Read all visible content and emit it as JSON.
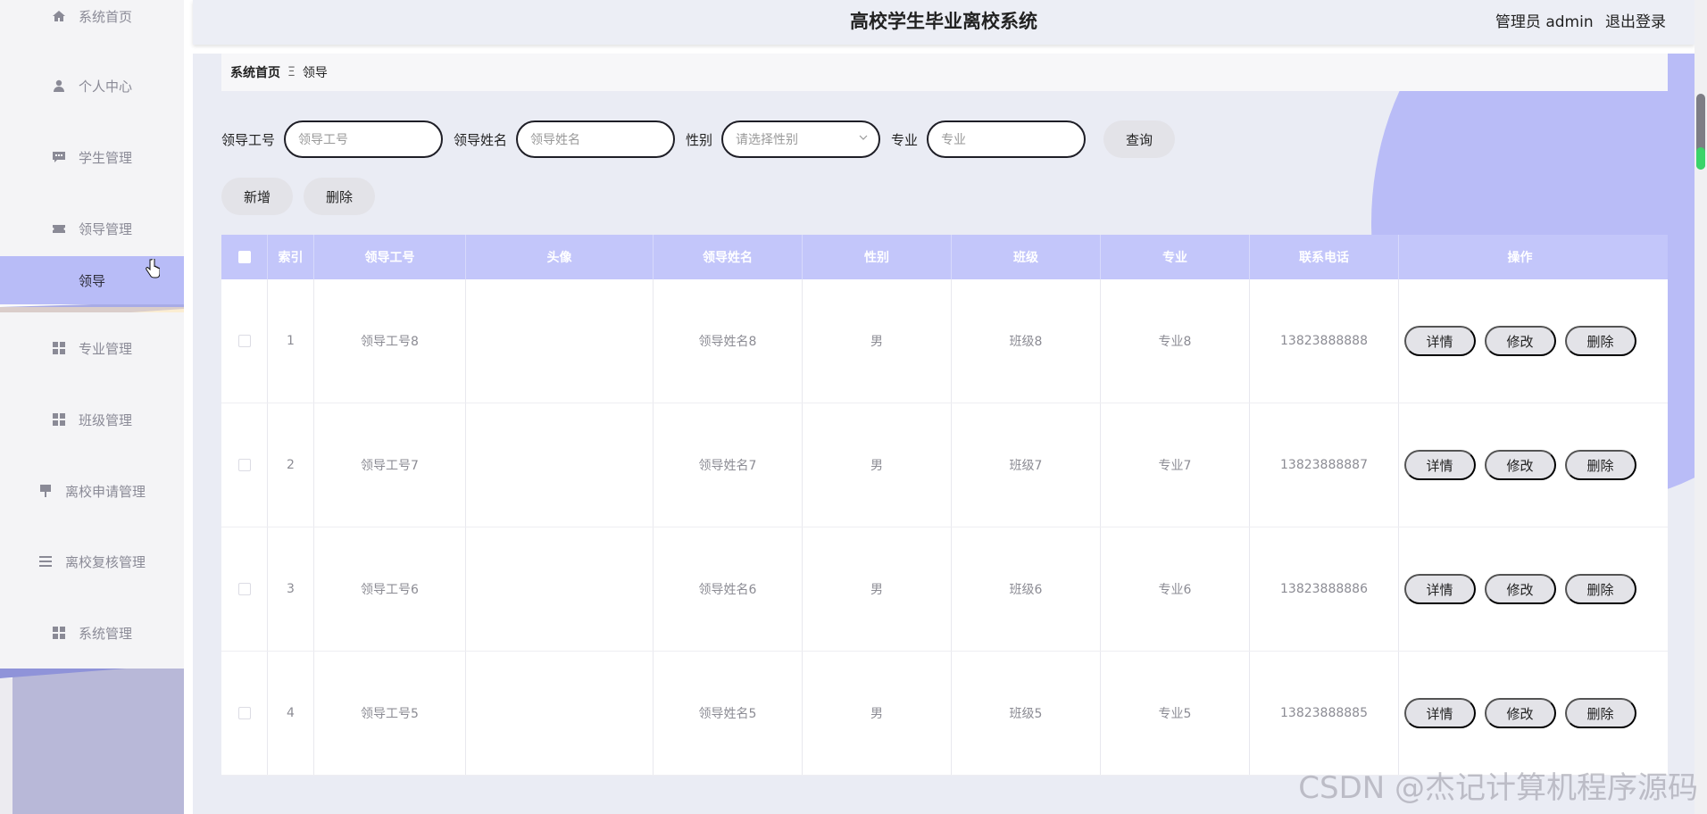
{
  "header": {
    "title": "高校学生毕业离校系统",
    "user_label": "管理员 admin",
    "logout_label": "退出登录"
  },
  "sidebar": {
    "items": [
      {
        "label": "系统首页",
        "icon": "home-icon"
      },
      {
        "label": "个人中心",
        "icon": "user-icon"
      },
      {
        "label": "学生管理",
        "icon": "chat-icon"
      },
      {
        "label": "领导管理",
        "icon": "ticket-icon"
      },
      {
        "label": "领导",
        "icon": "",
        "sub": true,
        "active": true
      },
      {
        "label": "专业管理",
        "icon": "grid-icon"
      },
      {
        "label": "班级管理",
        "icon": "grid-icon"
      },
      {
        "label": "离校申请管理",
        "icon": "flag-icon"
      },
      {
        "label": "离校复核管理",
        "icon": "list-icon"
      },
      {
        "label": "系统管理",
        "icon": "grid-icon"
      }
    ]
  },
  "breadcrumb": {
    "home": "系统首页",
    "separator": "Ξ",
    "current": "领导"
  },
  "search": {
    "id_label": "领导工号",
    "id_placeholder": "领导工号",
    "name_label": "领导姓名",
    "name_placeholder": "领导姓名",
    "gender_label": "性别",
    "gender_placeholder": "请选择性别",
    "major_label": "专业",
    "major_placeholder": "专业",
    "query_label": "查询"
  },
  "actions": {
    "add_label": "新增",
    "delete_label": "删除"
  },
  "table": {
    "headers": [
      "索引",
      "领导工号",
      "头像",
      "领导姓名",
      "性别",
      "班级",
      "专业",
      "联系电话",
      "操作"
    ],
    "rows": [
      {
        "index": "1",
        "id": "领导工号8",
        "name": "领导姓名8",
        "gender": "男",
        "class": "班级8",
        "major": "专业8",
        "phone": "13823888888"
      },
      {
        "index": "2",
        "id": "领导工号7",
        "name": "领导姓名7",
        "gender": "男",
        "class": "班级7",
        "major": "专业7",
        "phone": "13823888887"
      },
      {
        "index": "3",
        "id": "领导工号6",
        "name": "领导姓名6",
        "gender": "男",
        "class": "班级6",
        "major": "专业6",
        "phone": "13823888886"
      },
      {
        "index": "4",
        "id": "领导工号5",
        "name": "领导姓名5",
        "gender": "男",
        "class": "班级5",
        "major": "专业5",
        "phone": "13823888885"
      }
    ],
    "row_actions": {
      "detail": "详情",
      "edit": "修改",
      "delete": "删除"
    }
  },
  "watermark": "CSDN @杰记计算机程序源码",
  "colors": {
    "accent": "#c3c6fa",
    "active_menu": "#b8bcf7",
    "main_bg": "#eaecf4"
  }
}
